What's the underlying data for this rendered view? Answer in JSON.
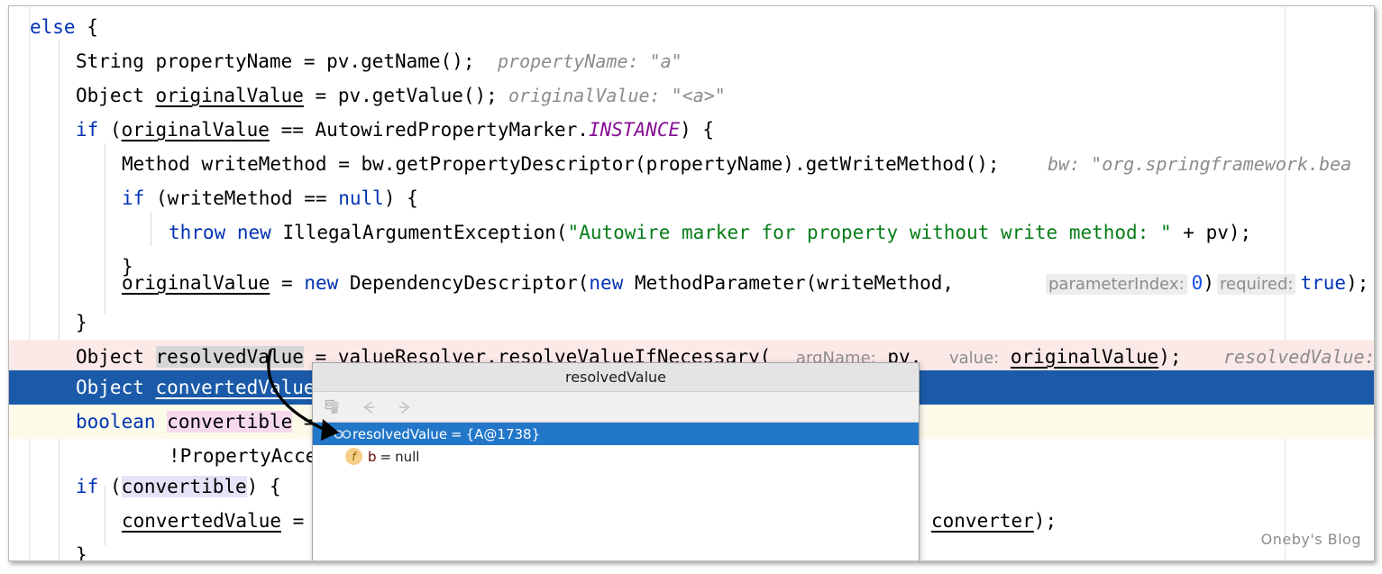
{
  "watermark": "Oneby's Blog",
  "editor": {
    "lines": [
      {
        "indent": 0,
        "text": "else {"
      },
      {
        "indent": 1,
        "text": "String propertyName = pv.getName();"
      },
      {
        "indent": 1,
        "text": "Object originalValue = pv.getValue();"
      },
      {
        "indent": 1,
        "text": "if (originalValue == AutowiredPropertyMarker.INSTANCE) {"
      },
      {
        "indent": 2,
        "text": "Method writeMethod = bw.getPropertyDescriptor(propertyName).getWriteMethod();"
      },
      {
        "indent": 2,
        "text": "if (writeMethod == null) {"
      },
      {
        "indent": 3,
        "text": "throw new IllegalArgumentException(\"Autowire marker for property without write method: \" + pv);"
      },
      {
        "indent": 2,
        "text": "}"
      },
      {
        "indent": 2,
        "text": "originalValue = new DependencyDescriptor(new MethodParameter(writeMethod, 0), true);"
      },
      {
        "indent": 1,
        "text": "}"
      },
      {
        "indent": 1,
        "text": "Object resolvedValue = valueResolver.resolveValueIfNecessary( pv, originalValue);"
      },
      {
        "indent": 1,
        "text": "Object convertedValue = resolvedValue;"
      },
      {
        "indent": 1,
        "text": "boolean convertible = "
      },
      {
        "indent": 3,
        "text": "!PropertyAcce"
      },
      {
        "indent": 1,
        "text": "if (convertible) {"
      },
      {
        "indent": 2,
        "text": "convertedValue = converter);"
      },
      {
        "indent": 1,
        "text": "}"
      }
    ],
    "inlay_hints": {
      "property_name": "propertyName: \"a\"",
      "original_value": "originalValue: \"<a>\"",
      "bw": "bw: \"org.springframework.bea",
      "parameter_index_label": "parameterIndex:",
      "parameter_index_value": "0",
      "required_label": "required:",
      "required_value": "true",
      "arg_name_label": "argName:",
      "arg_name_value": "pv,",
      "value_label": "value:",
      "value_value": "originalValue",
      "resolved_value_trailing": "resolvedValue:"
    }
  },
  "popup": {
    "title": "resolvedValue",
    "toolbar": {
      "copy_label": "copy-value",
      "back_label": "back",
      "forward_label": "forward"
    },
    "tree": [
      {
        "expanded": true,
        "icon": "watch-glasses-icon",
        "name": "resolvedValue",
        "eq": "=",
        "value": "{A@1738}",
        "selected": true
      },
      {
        "expanded": false,
        "icon": "field-icon",
        "name": "b",
        "eq": "=",
        "value": "null",
        "selected": false
      }
    ]
  },
  "colors": {
    "keyword": "#0033b3",
    "string": "#067d17",
    "number": "#1750eb",
    "static_field": "#871094",
    "hint": "#8c8c8c",
    "selection": "#1b5aa8",
    "exec_line": "#fbe9e7",
    "caret_line": "#fcfbea",
    "tree_selection": "#2277c9"
  }
}
